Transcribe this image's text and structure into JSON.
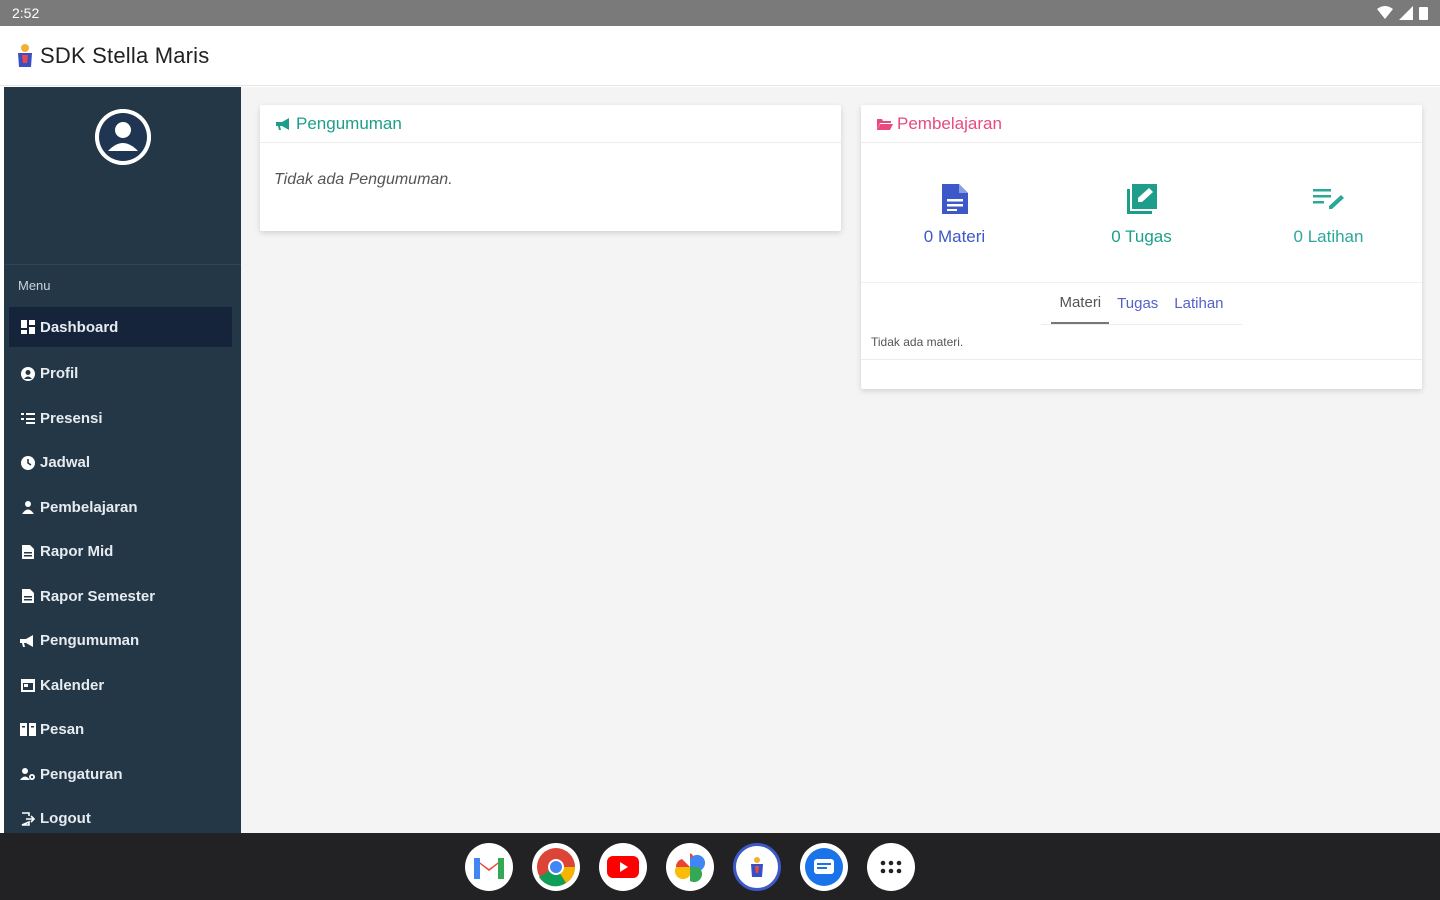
{
  "status_bar": {
    "time": "2:52"
  },
  "app_bar": {
    "title": "SDK Stella Maris"
  },
  "sidebar": {
    "menu_heading": "Menu",
    "items": [
      {
        "label": "Dashboard",
        "icon": "dashboard-icon",
        "active": true
      },
      {
        "label": "Profil",
        "icon": "user-circle-icon"
      },
      {
        "label": "Presensi",
        "icon": "checklist-icon"
      },
      {
        "label": "Jadwal",
        "icon": "clock-icon"
      },
      {
        "label": "Pembelajaran",
        "icon": "teacher-icon"
      },
      {
        "label": "Rapor Mid",
        "icon": "file-icon"
      },
      {
        "label": "Rapor Semester",
        "icon": "file-icon"
      },
      {
        "label": "Pengumuman",
        "icon": "megaphone-icon"
      },
      {
        "label": "Kalender",
        "icon": "calendar-icon"
      },
      {
        "label": "Pesan",
        "icon": "message-icon"
      },
      {
        "label": "Pengaturan",
        "icon": "settings-users-icon"
      },
      {
        "label": "Logout",
        "icon": "logout-icon"
      }
    ]
  },
  "announcement_card": {
    "title": "Pengumuman",
    "empty_text": "Tidak ada Pengumuman."
  },
  "learning_card": {
    "title": "Pembelajaran",
    "stats": {
      "materi": "0 Materi",
      "tugas": "0 Tugas",
      "latihan": "0 Latihan"
    },
    "tabs": [
      "Materi",
      "Tugas",
      "Latihan"
    ],
    "empty_text": "Tidak ada materi."
  },
  "colors": {
    "sidebar_bg": "#243747",
    "green": "#1e9e8a",
    "pink": "#e84a7f",
    "blue": "#3c58c9"
  },
  "dock_apps": [
    "gmail-icon",
    "chrome-icon",
    "youtube-icon",
    "photos-icon",
    "app-icon",
    "messages-icon",
    "app-drawer-icon"
  ]
}
